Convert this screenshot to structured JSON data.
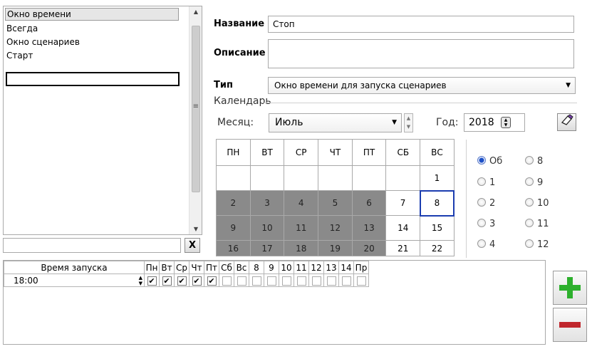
{
  "scenarios": {
    "items": [
      {
        "label": "Окно времени",
        "selected": true
      },
      {
        "label": "Всегда",
        "selected": false
      },
      {
        "label": "Окно сценариев",
        "selected": false
      },
      {
        "label": "Старт",
        "selected": false
      }
    ],
    "edit_value": "",
    "filter_value": "",
    "clear_label": "X"
  },
  "form": {
    "name_label": "Название",
    "name_value": "Стоп",
    "description_label": "Описание",
    "description_value": "",
    "type_label": "Тип",
    "type_value": "Окно времени для запуска сценариев"
  },
  "calendar": {
    "caption": "Календарь",
    "month_label": "Месяц:",
    "month_value": "Июль",
    "year_label": "Год:",
    "year_value": "2018",
    "weekdays": [
      "ПН",
      "ВТ",
      "СР",
      "ЧТ",
      "ПТ",
      "СБ",
      "ВС"
    ],
    "weeks": [
      [
        "",
        "",
        "",
        "",
        "",
        "",
        "1"
      ],
      [
        "2",
        "3",
        "4",
        "5",
        "6",
        "7",
        "8"
      ],
      [
        "9",
        "10",
        "11",
        "12",
        "13",
        "14",
        "15"
      ],
      [
        "16",
        "17",
        "18",
        "19",
        "20",
        "21",
        "22"
      ]
    ],
    "highlighted_days": [
      "2",
      "3",
      "4",
      "5",
      "6",
      "9",
      "10",
      "11",
      "12",
      "13",
      "16",
      "17",
      "18",
      "19",
      "20"
    ],
    "current_day": "8",
    "radio_options": [
      {
        "label": "Об",
        "checked": true
      },
      {
        "label": "8",
        "checked": false
      },
      {
        "label": "1",
        "checked": false
      },
      {
        "label": "9",
        "checked": false
      },
      {
        "label": "2",
        "checked": false
      },
      {
        "label": "10",
        "checked": false
      },
      {
        "label": "3",
        "checked": false
      },
      {
        "label": "11",
        "checked": false
      },
      {
        "label": "4",
        "checked": false
      },
      {
        "label": "12",
        "checked": false
      }
    ]
  },
  "schedule": {
    "columns": [
      "Время запуска",
      "Пн",
      "Вт",
      "Ср",
      "Чт",
      "Пт",
      "Сб",
      "Вс",
      "8",
      "9",
      "10",
      "11",
      "12",
      "13",
      "14",
      "Пр"
    ],
    "rows": [
      {
        "time": "18:00",
        "checks": [
          true,
          true,
          true,
          true,
          true,
          false,
          false,
          false,
          false,
          false,
          false,
          false,
          false,
          false,
          false
        ]
      }
    ]
  },
  "colors": {
    "highlight_day": "#8a8a8a",
    "today_border": "#1b3db0",
    "add_icon": "#2db02d",
    "remove_icon": "#c0272d"
  },
  "icons": {
    "scroll_up": "up-arrow-icon",
    "scroll_down": "down-arrow-icon",
    "clear": "close-icon",
    "combo": "chevron-down-icon",
    "spin": "spin-icon",
    "brush": "eraser-icon",
    "add": "plus-icon",
    "remove": "minus-icon"
  }
}
